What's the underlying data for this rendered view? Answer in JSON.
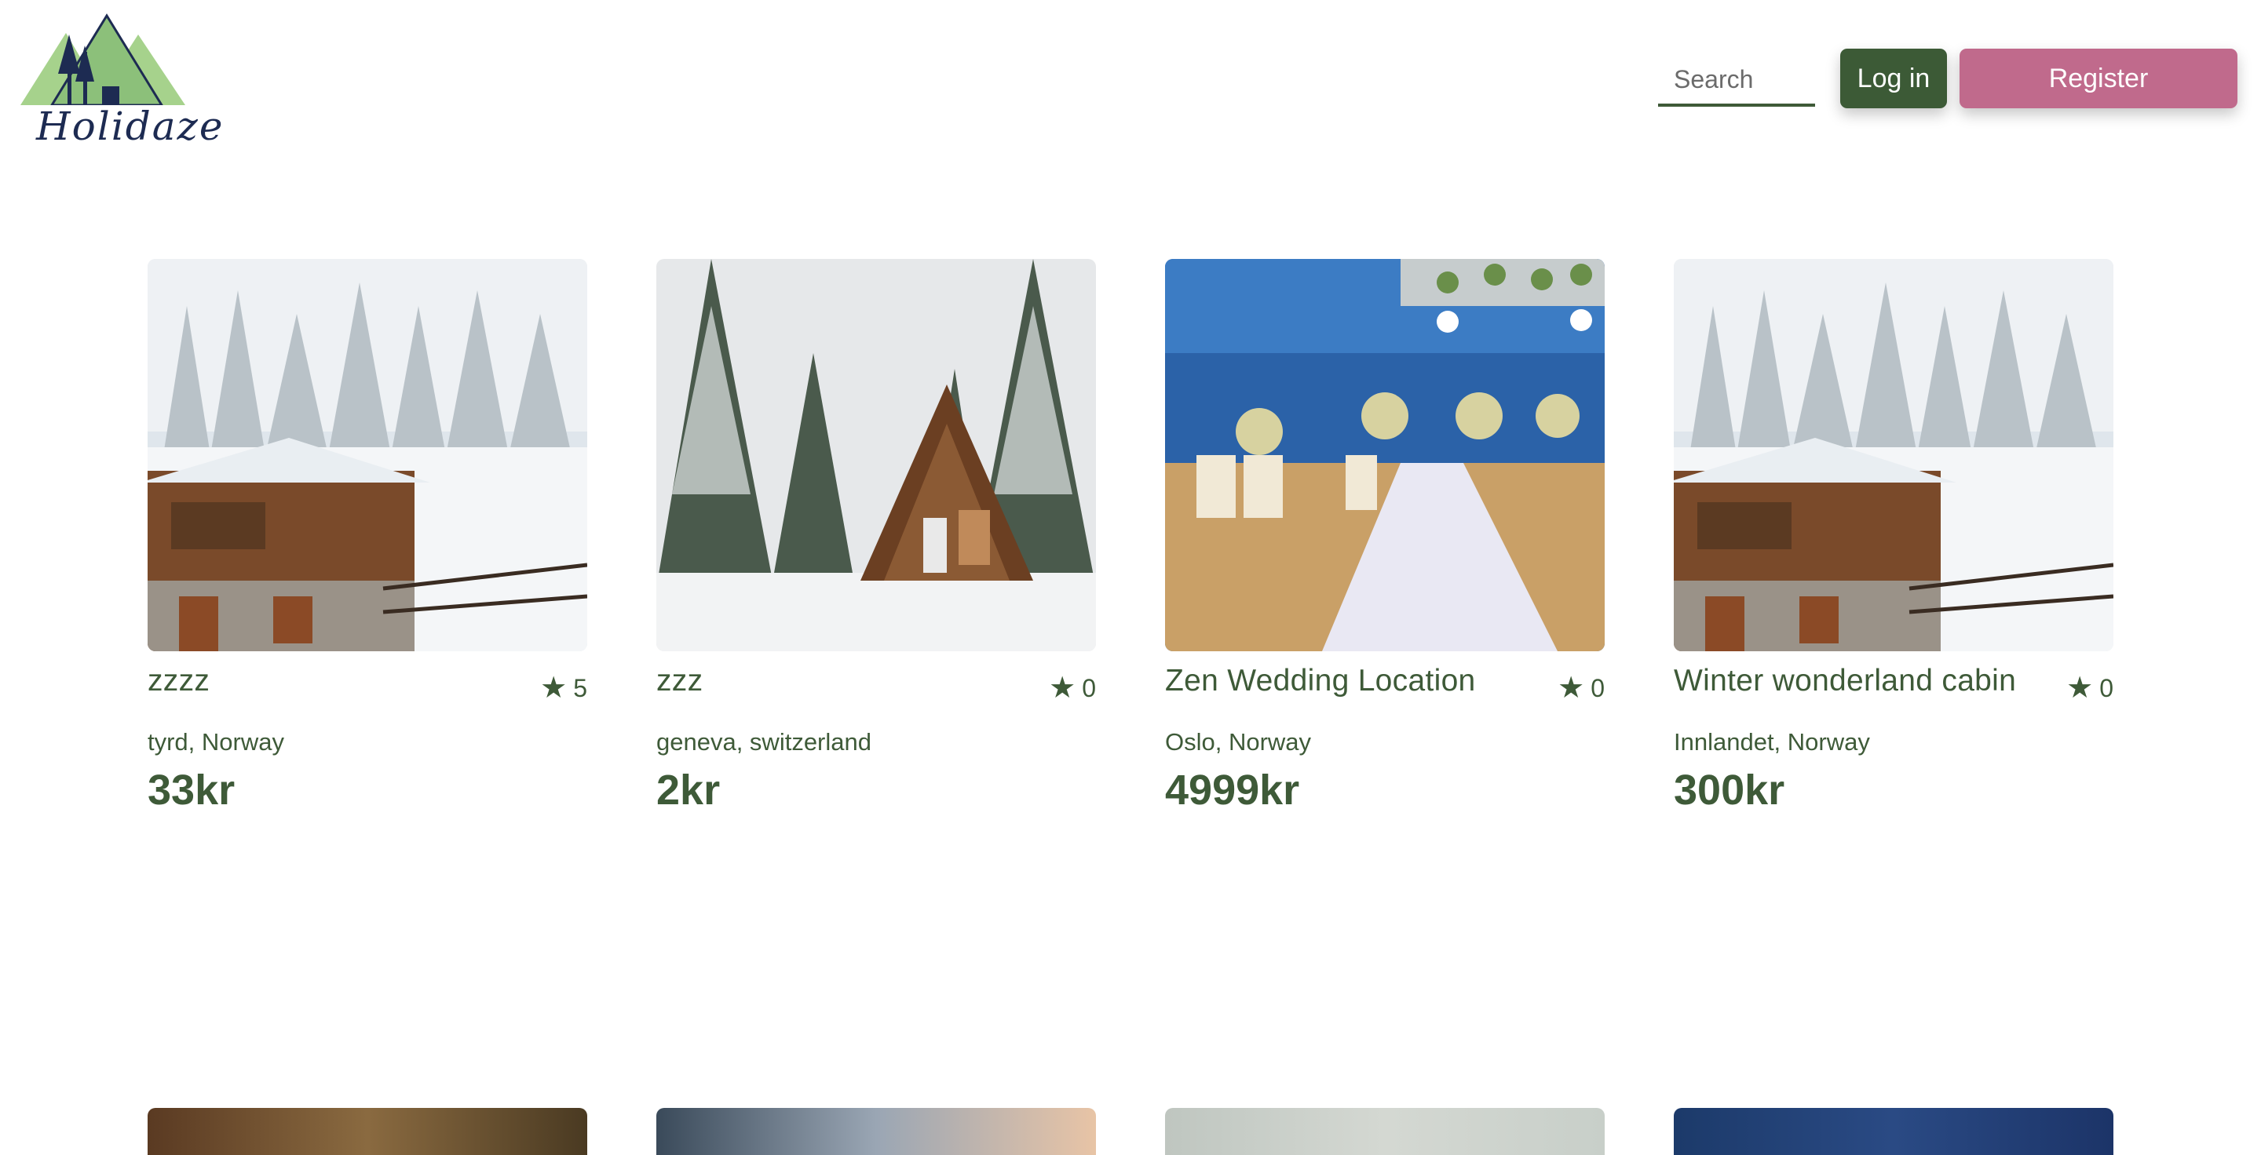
{
  "header": {
    "logo_text": "Holidaze",
    "search_placeholder": "Search",
    "login_label": "Log in",
    "register_label": "Register"
  },
  "colors": {
    "primary_green": "#3c5a36",
    "register_pink": "#c06a8c",
    "text_green": "#3e5a38"
  },
  "listings": [
    {
      "title": "zzzz",
      "rating": "5",
      "location": "tyrd, Norway",
      "price": "33kr",
      "image": "snowy-chalet-image"
    },
    {
      "title": "zzz",
      "rating": "0",
      "location": "geneva, switzerland",
      "price": "2kr",
      "image": "a-frame-cabin-image"
    },
    {
      "title": "Zen Wedding Location",
      "rating": "0",
      "location": "Oslo, Norway",
      "price": "4999kr",
      "image": "beach-wedding-image"
    },
    {
      "title": "Winter wonderland cabin",
      "rating": "0",
      "location": "Innlandet, Norway",
      "price": "300kr",
      "image": "snowy-chalet-image"
    }
  ],
  "icons": {
    "rating": "star-icon"
  }
}
